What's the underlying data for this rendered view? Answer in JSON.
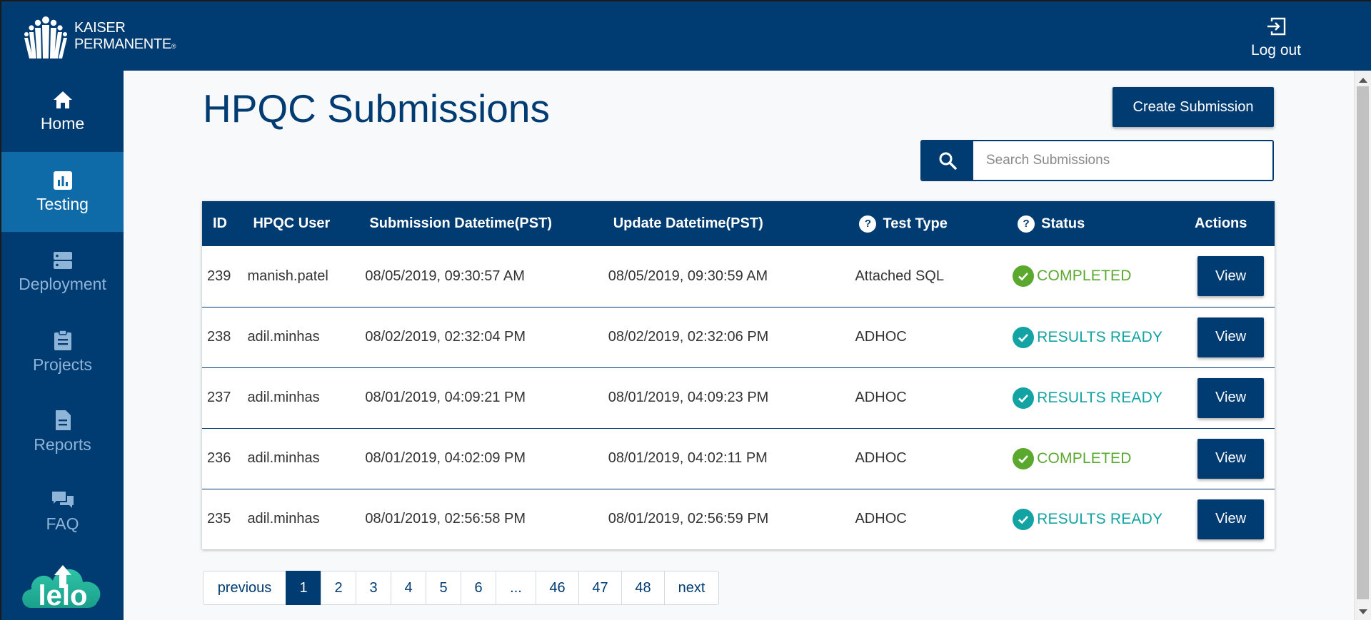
{
  "header": {
    "logo_line1": "KAISER",
    "logo_line2": "PERMANENTE",
    "logo_mark": "®",
    "logout_label": "Log out"
  },
  "sidebar": {
    "items": [
      {
        "label": "Home",
        "icon": "home-icon"
      },
      {
        "label": "Testing",
        "icon": "bar-chart-icon"
      },
      {
        "label": "Deployment",
        "icon": "server-icon"
      },
      {
        "label": "Projects",
        "icon": "clipboard-icon"
      },
      {
        "label": "Reports",
        "icon": "document-icon"
      },
      {
        "label": "FAQ",
        "icon": "chat-icon"
      }
    ],
    "active_index": 1,
    "brand_logo": "lelo"
  },
  "main": {
    "title": "HPQC Submissions",
    "create_label": "Create Submission",
    "search": {
      "placeholder": "Search Submissions",
      "value": ""
    }
  },
  "table": {
    "columns": [
      "ID",
      "HPQC User",
      "Submission Datetime(PST)",
      "Update Datetime(PST)",
      "Test Type",
      "Status",
      "Actions"
    ],
    "rows": [
      {
        "id": "239",
        "user": "manish.patel",
        "submitted": "08/05/2019, 09:30:57 AM",
        "updated": "08/05/2019, 09:30:59 AM",
        "type": "Attached SQL",
        "status": "COMPLETED",
        "action": "View"
      },
      {
        "id": "238",
        "user": "adil.minhas",
        "submitted": "08/02/2019, 02:32:04 PM",
        "updated": "08/02/2019, 02:32:06 PM",
        "type": "ADHOC",
        "status": "RESULTS READY",
        "action": "View"
      },
      {
        "id": "237",
        "user": "adil.minhas",
        "submitted": "08/01/2019, 04:09:21 PM",
        "updated": "08/01/2019, 04:09:23 PM",
        "type": "ADHOC",
        "status": "RESULTS READY",
        "action": "View"
      },
      {
        "id": "236",
        "user": "adil.minhas",
        "submitted": "08/01/2019, 04:02:09 PM",
        "updated": "08/01/2019, 04:02:11 PM",
        "type": "ADHOC",
        "status": "COMPLETED",
        "action": "View"
      },
      {
        "id": "235",
        "user": "adil.minhas",
        "submitted": "08/01/2019, 02:56:58 PM",
        "updated": "08/01/2019, 02:56:59 PM",
        "type": "ADHOC",
        "status": "RESULTS READY",
        "action": "View"
      }
    ],
    "help_icon_glyph": "?"
  },
  "pagination": {
    "previous": "previous",
    "pages": [
      "1",
      "2",
      "3",
      "4",
      "5",
      "6",
      "...",
      "46",
      "47",
      "48"
    ],
    "current": "1",
    "next": "next"
  },
  "colors": {
    "navy": "#003b71",
    "active_nav": "#0f6aa8",
    "completed": "#5aa82e",
    "results_ready": "#14a3a3"
  }
}
